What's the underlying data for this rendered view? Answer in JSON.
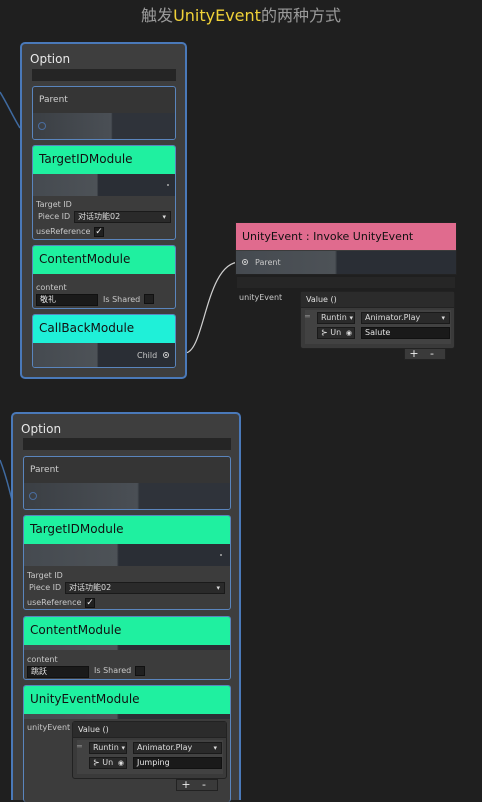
{
  "title": {
    "prefix": "触发",
    "highlight": "UnityEvent",
    "suffix": "的两种方式"
  },
  "colors": {
    "node_border": "#4a79b9",
    "module_green": "#1ff0a0",
    "module_cyan": "#1ff0d8",
    "event_header": "#e06b8e",
    "title_highlight": "#f0d238"
  },
  "node1": {
    "header": "Option",
    "parent_label": "Parent",
    "target_module": {
      "title": "TargetIDModule",
      "target_id_label": "Target ID",
      "piece_id_label": "Piece ID",
      "piece_id_value": "对话功能02",
      "use_reference_label": "useReference"
    },
    "content_module": {
      "title": "ContentModule",
      "content_label": "content",
      "content_value": "敬礼",
      "is_shared_label": "Is Shared"
    },
    "callback_module": {
      "title": "CallBackModule",
      "child_label": "Child"
    }
  },
  "unity_event_node": {
    "header": "UnityEvent : Invoke UnityEvent",
    "parent_label": "Parent",
    "field_label": "unityEvent",
    "event_title": "Value ()",
    "runtime_label": "Runtin",
    "method_label": "Animator.Play",
    "object_label": "Un",
    "argument_value": "Salute",
    "plus": "+",
    "minus": "-"
  },
  "node2": {
    "header": "Option",
    "parent_label": "Parent",
    "target_module": {
      "title": "TargetIDModule",
      "target_id_label": "Target ID",
      "piece_id_label": "Piece ID",
      "piece_id_value": "对话功能02",
      "use_reference_label": "useReference"
    },
    "content_module": {
      "title": "ContentModule",
      "content_label": "content",
      "content_value": "跳跃",
      "is_shared_label": "Is Shared"
    },
    "unity_event_module": {
      "title": "UnityEventModule",
      "field_label": "unityEvent",
      "event_title": "Value ()",
      "runtime_label": "Runtin",
      "method_label": "Animator.Play",
      "object_label": "Un",
      "argument_value": "Jumping",
      "plus": "+",
      "minus": "-"
    }
  }
}
